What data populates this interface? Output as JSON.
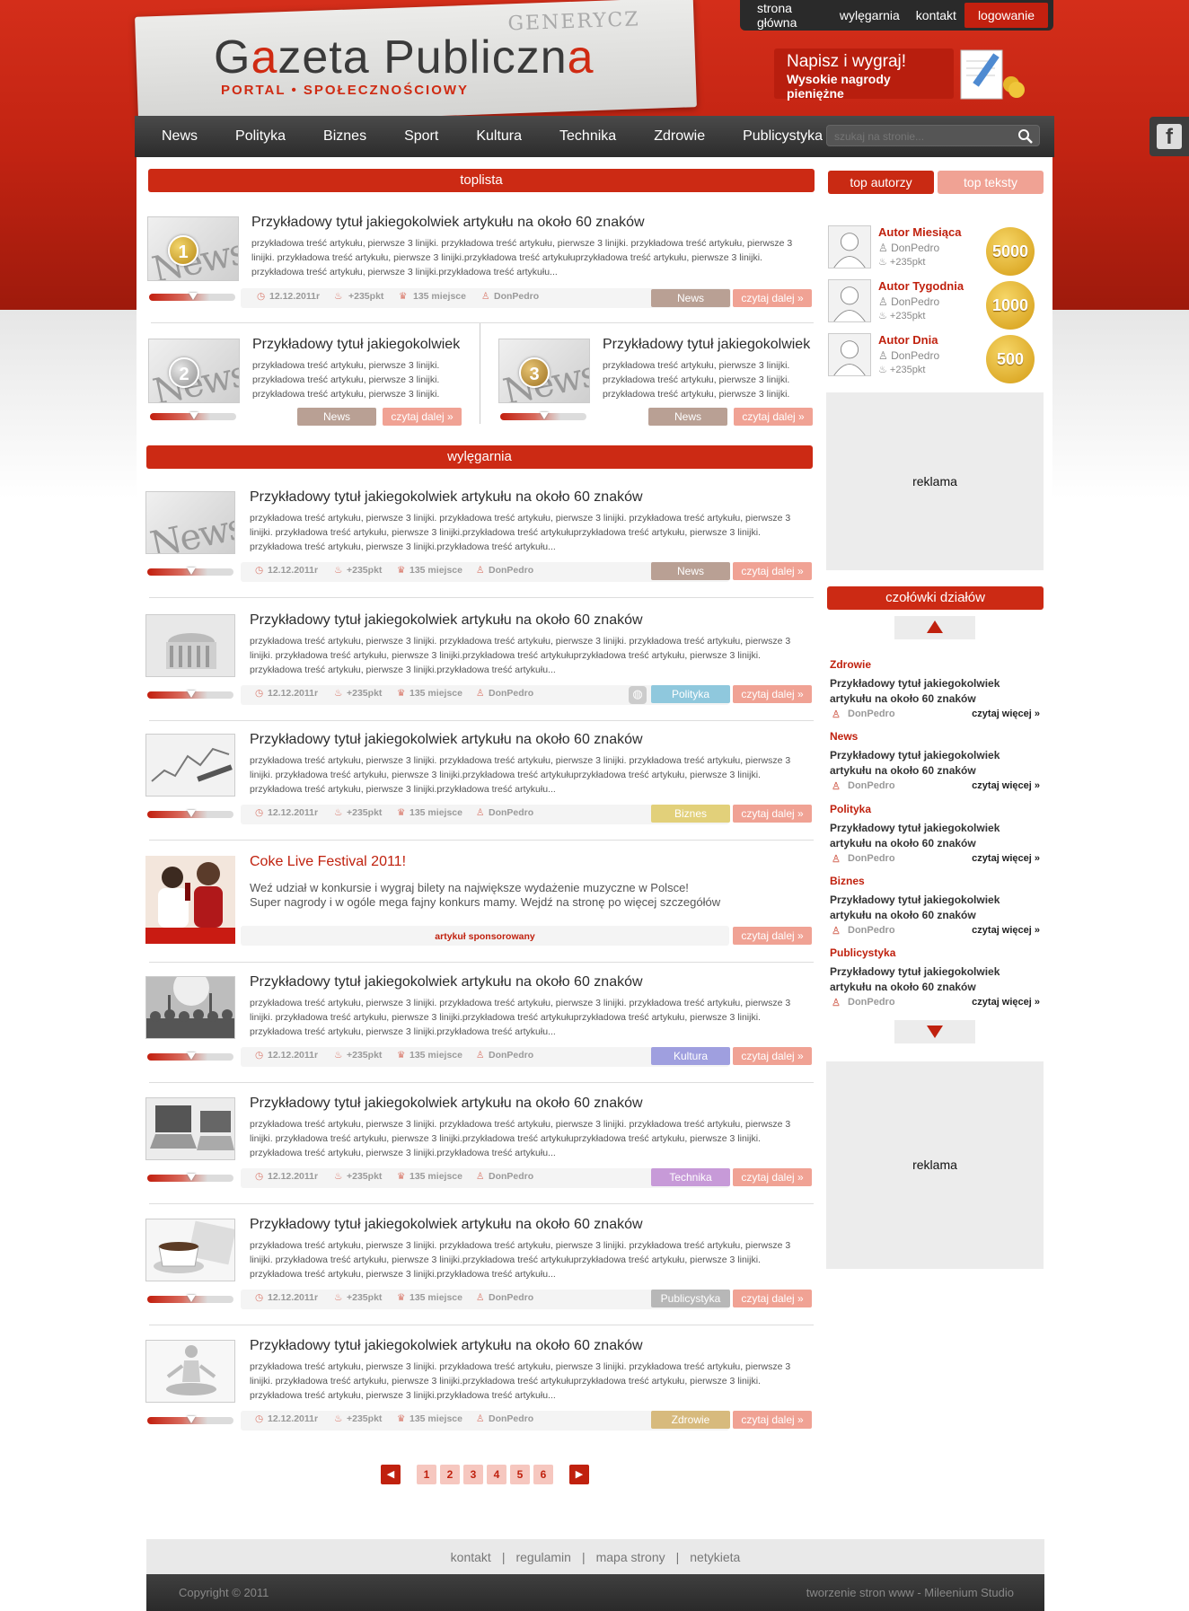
{
  "brand": {
    "logo_a": "G",
    "logo_b": "a",
    "logo_c": "zeta Publiczn",
    "logo_d": "a",
    "tagline": "PORTAL • SPOŁECZNOŚCIOWY"
  },
  "topnav": {
    "items": [
      "strona główna",
      "wylęgarnia",
      "kontakt"
    ],
    "login": "logowanie"
  },
  "promo": {
    "line1": "Napisz i wygraj!",
    "line2": "Wysokie nagrody pieniężne"
  },
  "mainnav": {
    "items": [
      "News",
      "Polityka",
      "Biznes",
      "Sport",
      "Kultura",
      "Technika",
      "Zdrowie",
      "Publicystyka i inne"
    ],
    "search_placeholder": "szukaj na stronie..."
  },
  "sections": {
    "toplista": "toplista",
    "wylegarnia": "wylęgarnia",
    "czolowki": "czołówki działów",
    "ad": "reklama"
  },
  "tabs": {
    "authors": "top autorzy",
    "texts": "top teksty"
  },
  "article_title": "Przykładowy tytuł jakiegokolwiek artykułu na około 60 znaków",
  "article_title_short": "Przykładowy tytuł jakiegokolwiek",
  "article_text": "przykładowa treść artykułu, pierwsze 3 linijki. przykładowa treść artykułu, pierwsze 3 linijki. przykładowa treść artykułu, pierwsze 3 linijki. przykładowa treść artykułu, pierwsze 3 linijki.przykładowa treść artykułuprzykładowa treść artykułu, pierwsze 3 linijki. przykładowa treść artykułu, pierwsze 3 linijki.przykładowa treść artykułu...",
  "article_text_short": "przykładowa treść artykułu, pierwsze 3 linijki. przykładowa treść artykułu, pierwsze 3 linijki. przykładowa treść artykułu, pierwsze 3 linijki.",
  "meta": {
    "date": "12.12.2011r",
    "points": "+235pkt",
    "rank": "135 miejsce",
    "author": "DonPedro",
    "more": "czytaj dalej »"
  },
  "top_medals": [
    "1",
    "2",
    "3"
  ],
  "categories": {
    "news": "News",
    "polityka": "Polityka",
    "biznes": "Biznes",
    "kultura": "Kultura",
    "technika": "Technika",
    "publicystyka": "Publicystyka",
    "zdrowie": "Zdrowie"
  },
  "category_colors": {
    "news": "#b9a094",
    "polityka": "#8fc8dd",
    "biznes": "#e2d07a",
    "kultura": "#9f9fdf",
    "technika": "#c79ad8",
    "publicystyka": "#b7b7b7",
    "zdrowie": "#d7ba7d"
  },
  "sponsored": {
    "title": "Coke Live Festival 2011!",
    "line1": "Weź udział w konkursie i wygraj bilety na największe wydażenie muzyczne w Polsce!",
    "line2": "Super nagrody i w ogóle mega fajny konkurs mamy. Wejdź  na stronę po więcej szczegółów",
    "label": "artykuł sponsorowany"
  },
  "authors": [
    {
      "title": "Autor Miesiąca",
      "user": "DonPedro",
      "points": "+235pkt",
      "badge": "5000"
    },
    {
      "title": "Autor Tygodnia",
      "user": "DonPedro",
      "points": "+235pkt",
      "badge": "1000"
    },
    {
      "title": "Autor Dnia",
      "user": "DonPedro",
      "points": "+235pkt",
      "badge": "500"
    }
  ],
  "headlines": [
    {
      "cat": "Zdrowie",
      "title": "Przykładowy tytuł jakiegokolwiek artykułu na około 60 znaków",
      "author": "DonPedro",
      "more": "czytaj więcej »"
    },
    {
      "cat": "News",
      "title": "Przykładowy tytuł jakiegokolwiek artykułu na około 60 znaków",
      "author": "DonPedro",
      "more": "czytaj więcej »"
    },
    {
      "cat": "Polityka",
      "title": "Przykładowy tytuł jakiegokolwiek artykułu na około 60 znaków",
      "author": "DonPedro",
      "more": "czytaj więcej »"
    },
    {
      "cat": "Biznes",
      "title": "Przykładowy tytuł jakiegokolwiek artykułu na około 60 znaków",
      "author": "DonPedro",
      "more": "czytaj więcej »"
    },
    {
      "cat": "Publicystyka",
      "title": "Przykładowy tytuł jakiegokolwiek artykułu na około 60 znaków",
      "author": "DonPedro",
      "more": "czytaj więcej »"
    }
  ],
  "pager": [
    "1",
    "2",
    "3",
    "4",
    "5",
    "6"
  ],
  "footer": {
    "links": [
      "kontakt",
      "regulamin",
      "mapa strony",
      "netykieta"
    ],
    "separator": "|",
    "copyright": "Copyright © 2011",
    "credit": "tworzenie stron www - Mileenium Studio"
  }
}
